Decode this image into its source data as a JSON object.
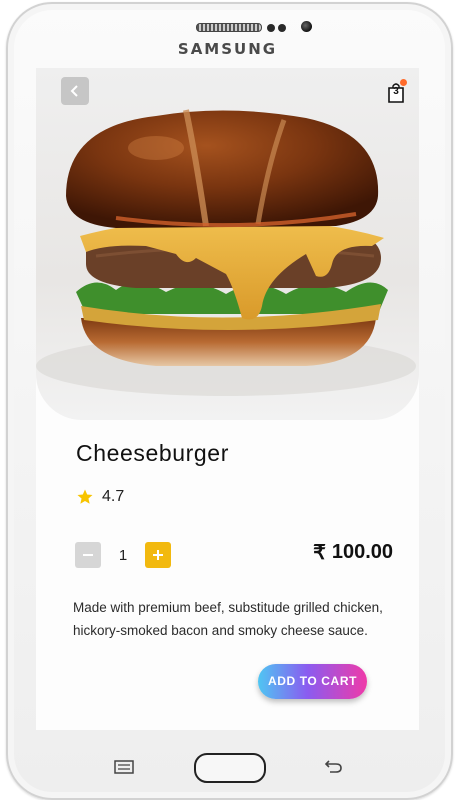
{
  "device": {
    "brand": "SAMSUNG"
  },
  "header": {
    "cart_count": "3"
  },
  "product": {
    "name": "Cheeseburger",
    "rating": "4.7",
    "quantity": "1",
    "currency_symbol": "₹",
    "price": "100.00",
    "description": "Made with premium beef, substitude grilled chicken, hickory-smoked bacon and smoky cheese sauce."
  },
  "actions": {
    "add_to_cart_label": "ADD TO CART"
  },
  "colors": {
    "accent_yellow": "#f2b90f",
    "button_gradient_start": "#4fc6f2",
    "button_gradient_end": "#ef3aa8",
    "star": "#f7c400"
  }
}
